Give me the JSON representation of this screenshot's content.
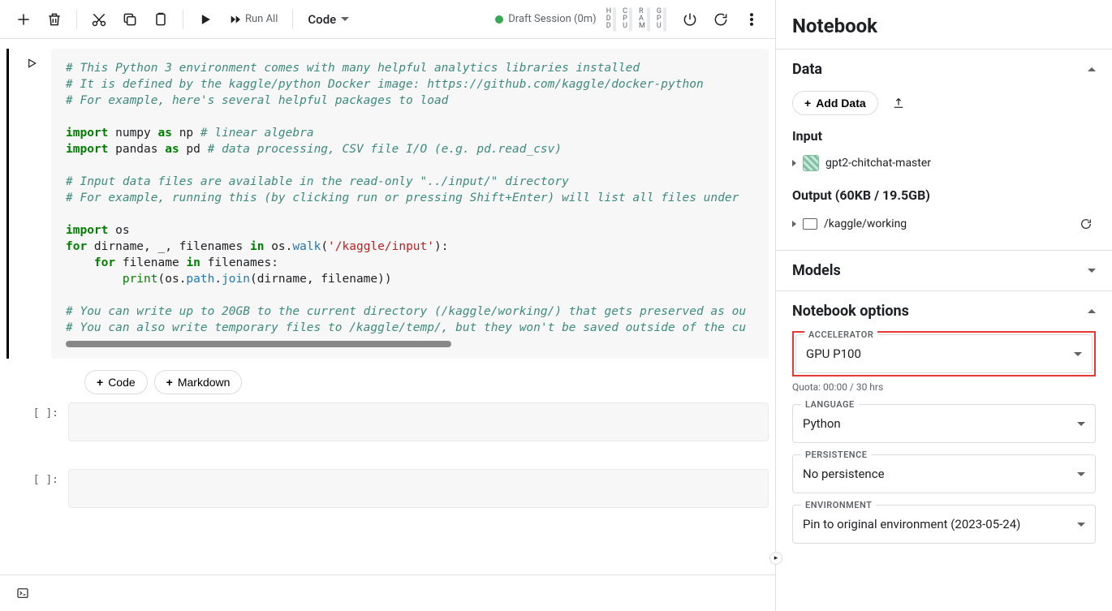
{
  "toolbar": {
    "run_all": "Run All",
    "cell_type": "Code",
    "session": "Draft Session (0m)",
    "meters": [
      "HDD",
      "CPU",
      "RAM",
      "GPU"
    ]
  },
  "add": {
    "code": "Code",
    "markdown": "Markdown"
  },
  "cells": {
    "prompt_empty": "[ ]:"
  },
  "code": {
    "c1": "# This Python 3 environment comes with many helpful analytics libraries installed",
    "c2": "# It is defined by the kaggle/python Docker image: https://github.com/kaggle/docker-python",
    "c3": "# For example, here's several helpful packages to load",
    "imp": "import",
    "as": "as",
    "numpy": " numpy ",
    "np": " np ",
    "c_la": "# linear algebra",
    "pandas": " pandas ",
    "pd": " pd ",
    "c_dp": "# data processing, CSV file I/O (e.g. pd.read_csv)",
    "c4": "# Input data files are available in the read-only \"../input/\" directory",
    "c5": "# For example, running this (by clicking run or pressing Shift+Enter) will list all files under ",
    "os": " os",
    "for": "for",
    "in": "in",
    "walk_line": " dirname, _, filenames ",
    "os_walk": " os.",
    "walk": "walk",
    "str_path": "'/kaggle/input'",
    "colon_close": "):",
    "for2_pre": "    ",
    "for2_mid": " filename ",
    "for2_end": " filenames:",
    "print_indent": "        ",
    "print": "print",
    "print_mid": "(os.",
    "path": "path",
    "dot": ".",
    "join": "join",
    "print_end": "(dirname, filename))",
    "c6": "# You can write up to 20GB to the current directory (/kaggle/working/) that gets preserved as ou",
    "c7": "# You can also write temporary files to /kaggle/temp/, but they won't be saved outside of the cu",
    "open_paren": "("
  },
  "sidebar": {
    "title": "Notebook",
    "data": "Data",
    "add_data": "Add Data",
    "input": "Input",
    "input_item": "gpt2-chitchat-master",
    "output": "Output (60KB / 19.5GB)",
    "output_item": "/kaggle/working",
    "models": "Models",
    "options": "Notebook options",
    "accel_label": "ACCELERATOR",
    "accel_value": "GPU P100",
    "quota": "Quota: 00:00 / 30 hrs",
    "lang_label": "LANGUAGE",
    "lang_value": "Python",
    "persist_label": "PERSISTENCE",
    "persist_value": "No persistence",
    "env_label": "ENVIRONMENT",
    "env_value": "Pin to original environment (2023-05-24)"
  }
}
